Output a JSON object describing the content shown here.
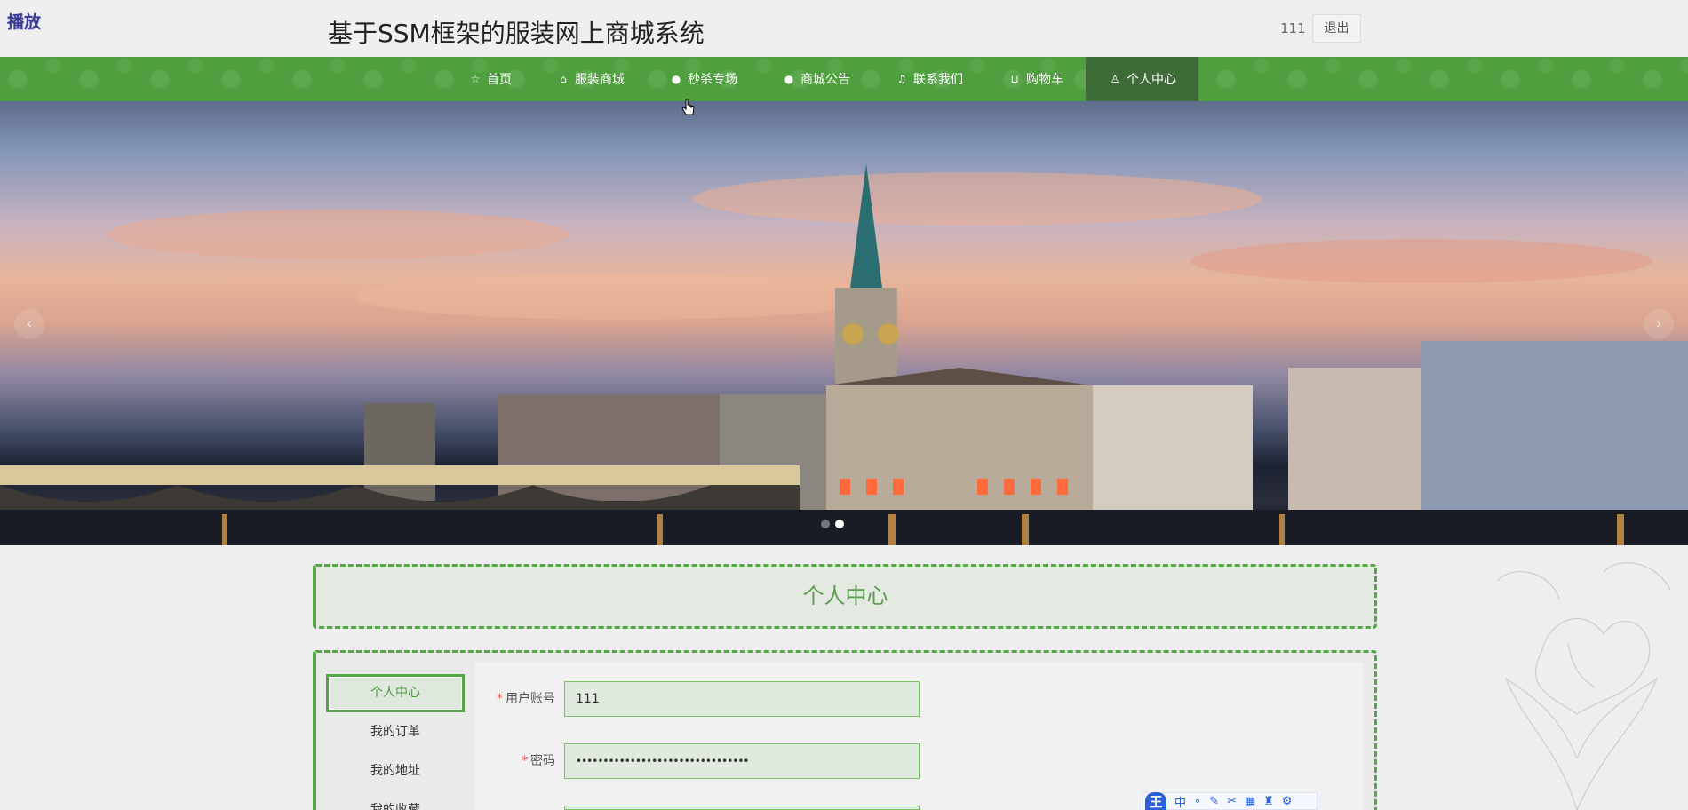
{
  "header": {
    "badge": "播放",
    "title": "基于SSM框架的服装网上商城系统",
    "username": "111",
    "logout_label": "退出"
  },
  "nav": {
    "items": [
      {
        "label": "首页",
        "icon": "star-icon"
      },
      {
        "label": "服装商城",
        "icon": "bag-icon"
      },
      {
        "label": "秒杀专场",
        "icon": "info-icon"
      },
      {
        "label": "商城公告",
        "icon": "help-icon"
      },
      {
        "label": "联系我们",
        "icon": "headset-icon"
      },
      {
        "label": "购物车",
        "icon": "cart-icon"
      },
      {
        "label": "个人中心",
        "icon": "user-icon"
      }
    ],
    "active_index": 6,
    "accent_color": "#4f9f3f"
  },
  "banner": {
    "slides": 2,
    "active_slide": 2
  },
  "page_title": "个人中心",
  "side_menu": {
    "items": [
      "个人中心",
      "我的订单",
      "我的地址",
      "我的收藏"
    ],
    "active_index": 0
  },
  "form": {
    "account_label": "用户账号",
    "account_value": "111",
    "password_label": "密码",
    "password_value": "••••••••••••••••••••••••••••••••",
    "required_mark": "*"
  },
  "ime_toolbar": {
    "logo": "王",
    "mode": "中",
    "icons": [
      "dots-icon",
      "pen-icon",
      "scissors-icon",
      "keyboard-icon",
      "shirt-icon",
      "gear-icon"
    ]
  }
}
